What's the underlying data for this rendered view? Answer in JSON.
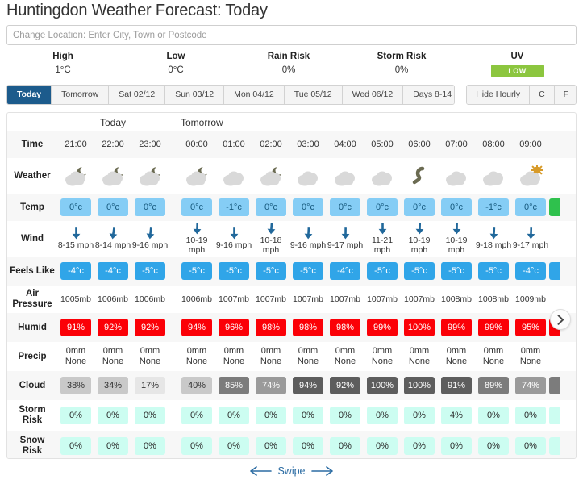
{
  "header": {
    "title": "Huntingdon Weather Forecast: Today",
    "search_placeholder": "Change Location: Enter City, Town or Postcode",
    "search_value": ""
  },
  "summary": [
    {
      "label": "High",
      "value": "1°C"
    },
    {
      "label": "Low",
      "value": "0°C"
    },
    {
      "label": "Rain Risk",
      "value": "0%"
    },
    {
      "label": "Storm Risk",
      "value": "0%"
    },
    {
      "label": "UV",
      "value": "LOW",
      "badge": true,
      "badge_color": "#8cc63f"
    }
  ],
  "tabs": {
    "day_tabs": [
      {
        "label": "Today",
        "active": true
      },
      {
        "label": "Tomorrow",
        "active": false
      },
      {
        "label": "Sat 02/12",
        "active": false
      },
      {
        "label": "Sun 03/12",
        "active": false
      },
      {
        "label": "Mon 04/12",
        "active": false
      },
      {
        "label": "Tue 05/12",
        "active": false
      },
      {
        "label": "Wed 06/12",
        "active": false
      },
      {
        "label": "Days 8-14",
        "active": false
      }
    ],
    "option_tabs": [
      {
        "label": "Hide Hourly"
      },
      {
        "label": "C"
      },
      {
        "label": "F"
      }
    ]
  },
  "forecast": {
    "groups": [
      {
        "name": "Today",
        "hours": 3
      },
      {
        "name": "Tomorrow",
        "hours": 10
      }
    ],
    "row_labels": {
      "time": "Time",
      "weather": "Weather",
      "temp": "Temp",
      "wind": "Wind",
      "feels_like": "Feels Like",
      "air_pressure": "Air Pressure",
      "humid": "Humid",
      "precip": "Precip",
      "cloud": "Cloud",
      "storm_risk": "Storm Risk",
      "snow_risk": "Snow Risk"
    },
    "time": [
      "21:00",
      "22:00",
      "23:00",
      "00:00",
      "01:00",
      "02:00",
      "03:00",
      "04:00",
      "05:00",
      "06:00",
      "07:00",
      "08:00",
      "09:00"
    ],
    "weather_icon": [
      "moon-cloud-icon",
      "moon-cloud-icon",
      "moon-cloud-icon",
      "moon-cloud-icon",
      "cloud-icon",
      "moon-cloud-icon",
      "cloud-icon",
      "cloud-icon",
      "cloud-icon",
      "mist-icon",
      "cloud-icon",
      "cloud-icon",
      "sun-cloud-icon"
    ],
    "temp": [
      "0°c",
      "0°c",
      "0°c",
      "0°c",
      "-1°c",
      "0°c",
      "0°c",
      "0°c",
      "0°c",
      "0°c",
      "0°c",
      "-1°c",
      "0°c"
    ],
    "wind": [
      "8-15 mph",
      "8-14 mph",
      "9-16 mph",
      "10-19 mph",
      "9-16 mph",
      "10-18 mph",
      "9-16 mph",
      "9-17 mph",
      "11-21 mph",
      "10-19 mph",
      "10-19 mph",
      "9-18 mph",
      "9-17 mph"
    ],
    "feels_like": [
      "-4°c",
      "-4°c",
      "-5°c",
      "-5°c",
      "-5°c",
      "-5°c",
      "-5°c",
      "-4°c",
      "-5°c",
      "-5°c",
      "-5°c",
      "-5°c",
      "-4°c"
    ],
    "air_pressure": [
      "1005mb",
      "1006mb",
      "1006mb",
      "1006mb",
      "1007mb",
      "1007mb",
      "1007mb",
      "1007mb",
      "1007mb",
      "1007mb",
      "1008mb",
      "1008mb",
      "1009mb"
    ],
    "humid": [
      "91%",
      "92%",
      "92%",
      "94%",
      "96%",
      "98%",
      "98%",
      "98%",
      "99%",
      "100%",
      "99%",
      "99%",
      "95%"
    ],
    "precip_amount": [
      "0mm",
      "0mm",
      "0mm",
      "0mm",
      "0mm",
      "0mm",
      "0mm",
      "0mm",
      "0mm",
      "0mm",
      "0mm",
      "0mm",
      "0mm"
    ],
    "precip_type": [
      "None",
      "None",
      "None",
      "None",
      "None",
      "None",
      "None",
      "None",
      "None",
      "None",
      "None",
      "None",
      "None"
    ],
    "cloud": [
      "38%",
      "34%",
      "17%",
      "40%",
      "85%",
      "74%",
      "94%",
      "92%",
      "100%",
      "100%",
      "91%",
      "89%",
      "74%"
    ],
    "storm_risk": [
      "0%",
      "0%",
      "0%",
      "0%",
      "0%",
      "0%",
      "0%",
      "0%",
      "0%",
      "0%",
      "4%",
      "0%",
      "0%"
    ],
    "snow_risk": [
      "0%",
      "0%",
      "0%",
      "0%",
      "0%",
      "0%",
      "0%",
      "0%",
      "0%",
      "0%",
      "0%",
      "0%",
      "0%"
    ],
    "scroll_next_icon": "chevron-right-icon",
    "swipe_hint": "Swipe"
  }
}
